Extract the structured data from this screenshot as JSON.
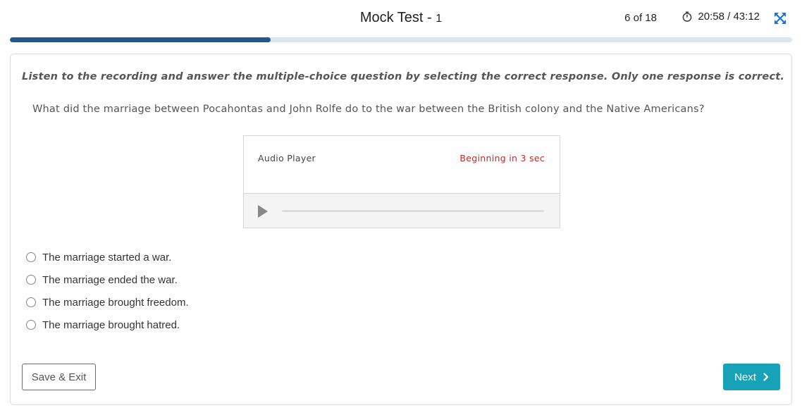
{
  "header": {
    "title": "Mock Test - ",
    "title_number": "1",
    "counter": "6 of 18",
    "timer": "20:58 / 43:12"
  },
  "progress": {
    "fraction": 0.333,
    "fill_color": "#1f5a8a",
    "track_color": "#d9e6ee"
  },
  "content": {
    "instruction": "Listen to the recording and answer the multiple-choice question by selecting the correct response. Only one response is correct.",
    "question": "What did the marriage between Pocahontas and John Rolfe do to the war between the British colony and the Native Americans?"
  },
  "audio": {
    "label": "Audio Player",
    "status": "Beginning in 3 sec",
    "status_color": "#c62828"
  },
  "options": [
    {
      "label": "The marriage started a war."
    },
    {
      "label": "The marriage ended the war."
    },
    {
      "label": "The marriage brought freedom."
    },
    {
      "label": "The marriage brought hatred."
    }
  ],
  "footer": {
    "save_label": "Save & Exit",
    "next_label": "Next",
    "next_color": "#17a2b8"
  },
  "icons": {
    "timer": "stopwatch-icon",
    "fullscreen": "fullscreen-icon",
    "play": "play-icon",
    "next": "chevron-right-icon"
  }
}
